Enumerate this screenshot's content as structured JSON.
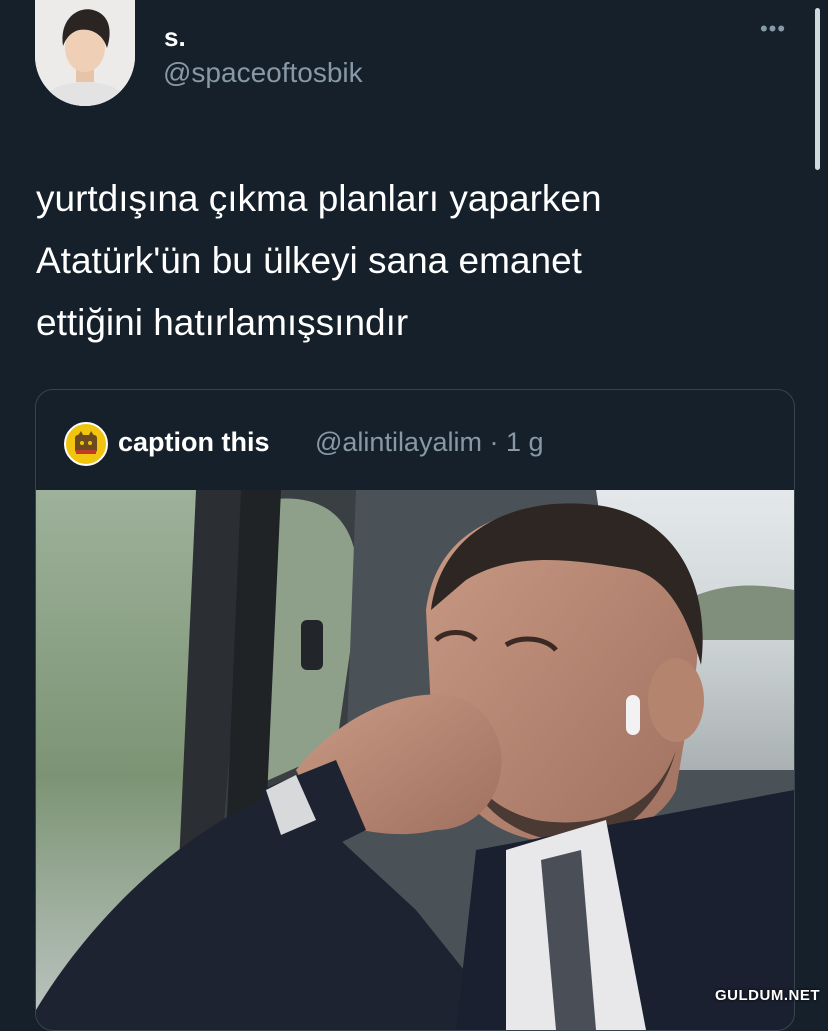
{
  "tweet": {
    "display_name": "s.",
    "handle": "@spaceoftosbik",
    "more_label": "•••",
    "text": "yurtdışına çıkma planları yaparken\nAtatürk'ün bu ülkeyi sana emanet\nettiğini hatırlamışsındır"
  },
  "quote": {
    "name": "caption this",
    "meta": "@alintilayalim · 1 g"
  },
  "watermark": "GULDUM.NET"
}
